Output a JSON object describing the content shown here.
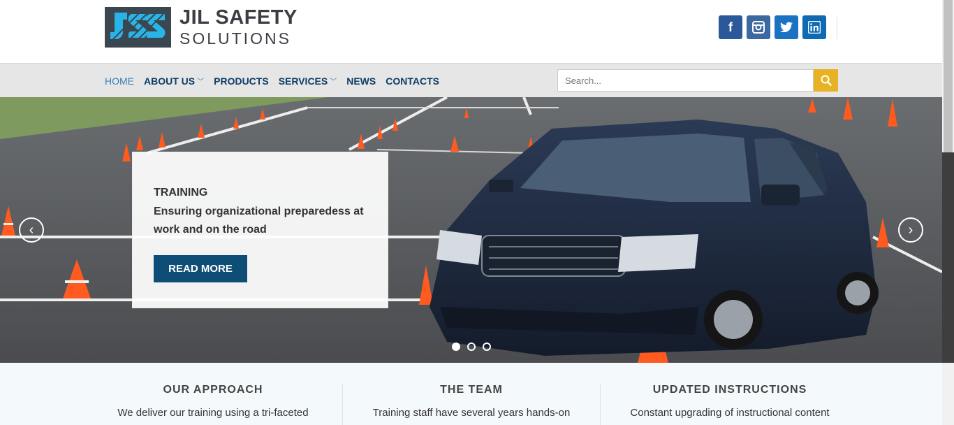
{
  "brand": {
    "line1": "JIL SAFETY",
    "line2": "SOLUTIONS",
    "logo_icon": "jss-logo-icon"
  },
  "social": [
    {
      "name": "facebook",
      "glyph": "f"
    },
    {
      "name": "instagram",
      "glyph": "◘"
    },
    {
      "name": "twitter",
      "glyph": "t"
    },
    {
      "name": "linkedin",
      "glyph": "in"
    }
  ],
  "nav": {
    "items": [
      {
        "label": "HOME",
        "active": true
      },
      {
        "label": "ABOUT US",
        "dropdown": true
      },
      {
        "label": "PRODUCTS"
      },
      {
        "label": "SERVICES",
        "dropdown": true
      },
      {
        "label": "NEWS"
      },
      {
        "label": "CONTACTS"
      }
    ],
    "search_placeholder": "Search..."
  },
  "hero": {
    "title": "TRAINING",
    "text": "Ensuring organizational preparedess at work and on the road",
    "button": "READ MORE",
    "prev": "‹",
    "next": "›",
    "slides": 3,
    "active_slide": 1
  },
  "features": [
    {
      "title": "OUR APPROACH",
      "text": "We deliver our training using a tri-faceted"
    },
    {
      "title": "THE TEAM",
      "text": "Training staff have several years hands-on"
    },
    {
      "title": "UPDATED INSTRUCTIONS",
      "text": "Constant upgrading of instructional content"
    }
  ],
  "colors": {
    "nav_text": "#0d3d66",
    "accent_search": "#e7b324",
    "button": "#0e4d76"
  }
}
